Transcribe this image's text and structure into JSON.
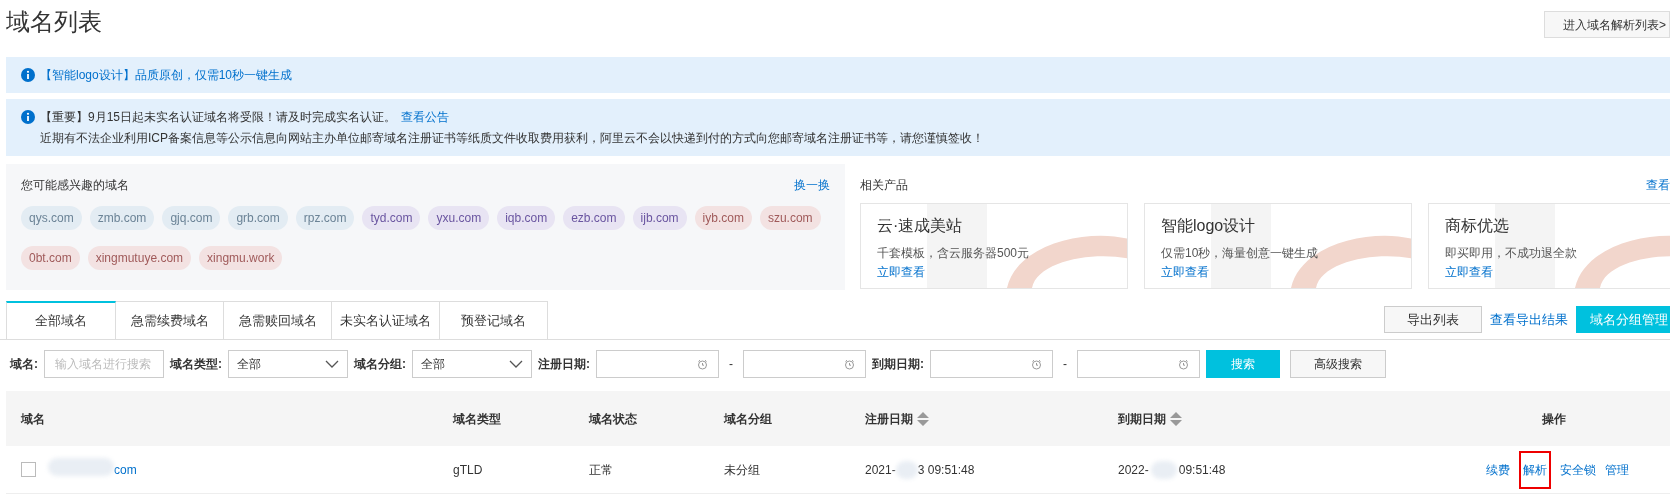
{
  "page_title": "域名列表",
  "header_button": "进入域名解析列表>",
  "notices": [
    {
      "parts": [
        {
          "text": "【智能logo设计】品质原创，仅需10秒一键生成",
          "link": true
        }
      ]
    },
    {
      "parts": [
        {
          "text": "【重要】9月15日起未实名认证域名将受限！请及时完成实名认证。",
          "link": false
        },
        {
          "text": "查看公告",
          "link": true
        }
      ],
      "detail": "近期有不法企业利用ICP备案信息等公示信息向网站主办单位邮寄域名注册证书等纸质文件收取费用获利，阿里云不会以快递到付的方式向您邮寄域名注册证书等，请您谨慎签收！"
    }
  ],
  "suggestions": {
    "title": "您可能感兴趣的域名",
    "refresh": "换一换",
    "tags": [
      {
        "label": "qys.com",
        "color": "#e3ecf3"
      },
      {
        "label": "zmb.com",
        "color": "#e3ecf3"
      },
      {
        "label": "gjq.com",
        "color": "#e3ecf3"
      },
      {
        "label": "grb.com",
        "color": "#e3ecf3"
      },
      {
        "label": "rpz.com",
        "color": "#e3ecf3"
      },
      {
        "label": "tyd.com",
        "color": "#e8e4f3"
      },
      {
        "label": "yxu.com",
        "color": "#e8e4f3"
      },
      {
        "label": "iqb.com",
        "color": "#e8e4f3"
      },
      {
        "label": "ezb.com",
        "color": "#e8e4f3"
      },
      {
        "label": "ijb.com",
        "color": "#e8e4f3"
      },
      {
        "label": "iyb.com",
        "color": "#f3e2e2"
      },
      {
        "label": "szu.com",
        "color": "#f3e2e2"
      },
      {
        "label": "0bt.com",
        "color": "#f3e2e2"
      },
      {
        "label": "xingmutuye.com",
        "color": "#f3e2e2"
      },
      {
        "label": "xingmu.work",
        "color": "#f3e2e2"
      }
    ]
  },
  "related": {
    "title": "相关产品",
    "more": "查看",
    "products": [
      {
        "name": "云·速成美站",
        "desc": "千套模板，含云服务器500元",
        "link": "立即查看"
      },
      {
        "name": "智能logo设计",
        "desc": "仅需10秒，海量创意一键生成",
        "link": "立即查看"
      },
      {
        "name": "商标优选",
        "desc": "即买即用，不成功退全款",
        "link": "立即查看"
      }
    ]
  },
  "tabs": [
    {
      "label": "全部域名",
      "selected": true
    },
    {
      "label": "急需续费域名",
      "selected": false
    },
    {
      "label": "急需赎回域名",
      "selected": false
    },
    {
      "label": "未实名认证域名",
      "selected": false
    },
    {
      "label": "预登记域名",
      "selected": false
    }
  ],
  "toolbar": {
    "export": "导出列表",
    "view_export": "查看导出结果",
    "group_manage": "域名分组管理"
  },
  "filters": {
    "domain_label": "域名:",
    "domain_placeholder": "输入域名进行搜索",
    "type_label": "域名类型:",
    "type_value": "全部",
    "group_label": "域名分组:",
    "group_value": "全部",
    "reg_label": "注册日期:",
    "exp_label": "到期日期:",
    "dash": "-",
    "search": "搜索",
    "advanced": "高级搜索"
  },
  "table": {
    "columns": [
      {
        "label": "域名",
        "kind": "plain"
      },
      {
        "label": "域名类型",
        "kind": "plain"
      },
      {
        "label": "域名状态",
        "kind": "plain"
      },
      {
        "label": "域名分组",
        "kind": "plain"
      },
      {
        "label": "注册日期",
        "kind": "sortable"
      },
      {
        "label": "到期日期",
        "kind": "sortable"
      },
      {
        "label": "操作",
        "kind": "plain"
      }
    ],
    "rows": [
      {
        "checked": false,
        "domain": "com",
        "type": "gTLD",
        "status": "正常",
        "group": "未分组",
        "reg_date": {
          "before": "2021-",
          "after": "3 09:51:48"
        },
        "exp_date": {
          "before": "2022-",
          "after": "09:51:48"
        },
        "actions": [
          {
            "label": "续费",
            "highlighted": false
          },
          {
            "label": "解析",
            "highlighted": true
          },
          {
            "label": "安全锁",
            "highlighted": false
          },
          {
            "label": "管理",
            "highlighted": false
          }
        ]
      }
    ]
  }
}
